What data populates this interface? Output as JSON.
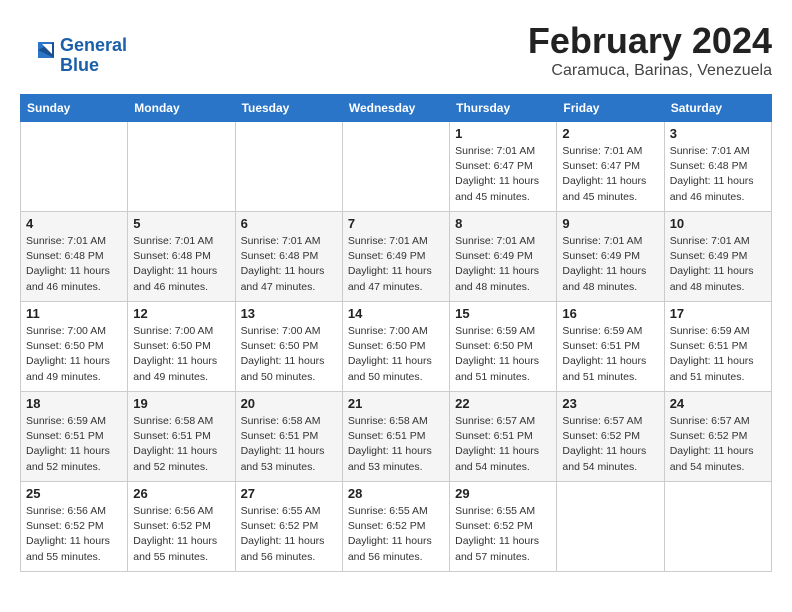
{
  "logo": {
    "line1": "General",
    "line2": "Blue"
  },
  "title": "February 2024",
  "subtitle": "Caramuca, Barinas, Venezuela",
  "days_header": [
    "Sunday",
    "Monday",
    "Tuesday",
    "Wednesday",
    "Thursday",
    "Friday",
    "Saturday"
  ],
  "weeks": [
    [
      {
        "num": "",
        "info": ""
      },
      {
        "num": "",
        "info": ""
      },
      {
        "num": "",
        "info": ""
      },
      {
        "num": "",
        "info": ""
      },
      {
        "num": "1",
        "info": "Sunrise: 7:01 AM\nSunset: 6:47 PM\nDaylight: 11 hours\nand 45 minutes."
      },
      {
        "num": "2",
        "info": "Sunrise: 7:01 AM\nSunset: 6:47 PM\nDaylight: 11 hours\nand 45 minutes."
      },
      {
        "num": "3",
        "info": "Sunrise: 7:01 AM\nSunset: 6:48 PM\nDaylight: 11 hours\nand 46 minutes."
      }
    ],
    [
      {
        "num": "4",
        "info": "Sunrise: 7:01 AM\nSunset: 6:48 PM\nDaylight: 11 hours\nand 46 minutes."
      },
      {
        "num": "5",
        "info": "Sunrise: 7:01 AM\nSunset: 6:48 PM\nDaylight: 11 hours\nand 46 minutes."
      },
      {
        "num": "6",
        "info": "Sunrise: 7:01 AM\nSunset: 6:48 PM\nDaylight: 11 hours\nand 47 minutes."
      },
      {
        "num": "7",
        "info": "Sunrise: 7:01 AM\nSunset: 6:49 PM\nDaylight: 11 hours\nand 47 minutes."
      },
      {
        "num": "8",
        "info": "Sunrise: 7:01 AM\nSunset: 6:49 PM\nDaylight: 11 hours\nand 48 minutes."
      },
      {
        "num": "9",
        "info": "Sunrise: 7:01 AM\nSunset: 6:49 PM\nDaylight: 11 hours\nand 48 minutes."
      },
      {
        "num": "10",
        "info": "Sunrise: 7:01 AM\nSunset: 6:49 PM\nDaylight: 11 hours\nand 48 minutes."
      }
    ],
    [
      {
        "num": "11",
        "info": "Sunrise: 7:00 AM\nSunset: 6:50 PM\nDaylight: 11 hours\nand 49 minutes."
      },
      {
        "num": "12",
        "info": "Sunrise: 7:00 AM\nSunset: 6:50 PM\nDaylight: 11 hours\nand 49 minutes."
      },
      {
        "num": "13",
        "info": "Sunrise: 7:00 AM\nSunset: 6:50 PM\nDaylight: 11 hours\nand 50 minutes."
      },
      {
        "num": "14",
        "info": "Sunrise: 7:00 AM\nSunset: 6:50 PM\nDaylight: 11 hours\nand 50 minutes."
      },
      {
        "num": "15",
        "info": "Sunrise: 6:59 AM\nSunset: 6:50 PM\nDaylight: 11 hours\nand 51 minutes."
      },
      {
        "num": "16",
        "info": "Sunrise: 6:59 AM\nSunset: 6:51 PM\nDaylight: 11 hours\nand 51 minutes."
      },
      {
        "num": "17",
        "info": "Sunrise: 6:59 AM\nSunset: 6:51 PM\nDaylight: 11 hours\nand 51 minutes."
      }
    ],
    [
      {
        "num": "18",
        "info": "Sunrise: 6:59 AM\nSunset: 6:51 PM\nDaylight: 11 hours\nand 52 minutes."
      },
      {
        "num": "19",
        "info": "Sunrise: 6:58 AM\nSunset: 6:51 PM\nDaylight: 11 hours\nand 52 minutes."
      },
      {
        "num": "20",
        "info": "Sunrise: 6:58 AM\nSunset: 6:51 PM\nDaylight: 11 hours\nand 53 minutes."
      },
      {
        "num": "21",
        "info": "Sunrise: 6:58 AM\nSunset: 6:51 PM\nDaylight: 11 hours\nand 53 minutes."
      },
      {
        "num": "22",
        "info": "Sunrise: 6:57 AM\nSunset: 6:51 PM\nDaylight: 11 hours\nand 54 minutes."
      },
      {
        "num": "23",
        "info": "Sunrise: 6:57 AM\nSunset: 6:52 PM\nDaylight: 11 hours\nand 54 minutes."
      },
      {
        "num": "24",
        "info": "Sunrise: 6:57 AM\nSunset: 6:52 PM\nDaylight: 11 hours\nand 54 minutes."
      }
    ],
    [
      {
        "num": "25",
        "info": "Sunrise: 6:56 AM\nSunset: 6:52 PM\nDaylight: 11 hours\nand 55 minutes."
      },
      {
        "num": "26",
        "info": "Sunrise: 6:56 AM\nSunset: 6:52 PM\nDaylight: 11 hours\nand 55 minutes."
      },
      {
        "num": "27",
        "info": "Sunrise: 6:55 AM\nSunset: 6:52 PM\nDaylight: 11 hours\nand 56 minutes."
      },
      {
        "num": "28",
        "info": "Sunrise: 6:55 AM\nSunset: 6:52 PM\nDaylight: 11 hours\nand 56 minutes."
      },
      {
        "num": "29",
        "info": "Sunrise: 6:55 AM\nSunset: 6:52 PM\nDaylight: 11 hours\nand 57 minutes."
      },
      {
        "num": "",
        "info": ""
      },
      {
        "num": "",
        "info": ""
      }
    ]
  ]
}
